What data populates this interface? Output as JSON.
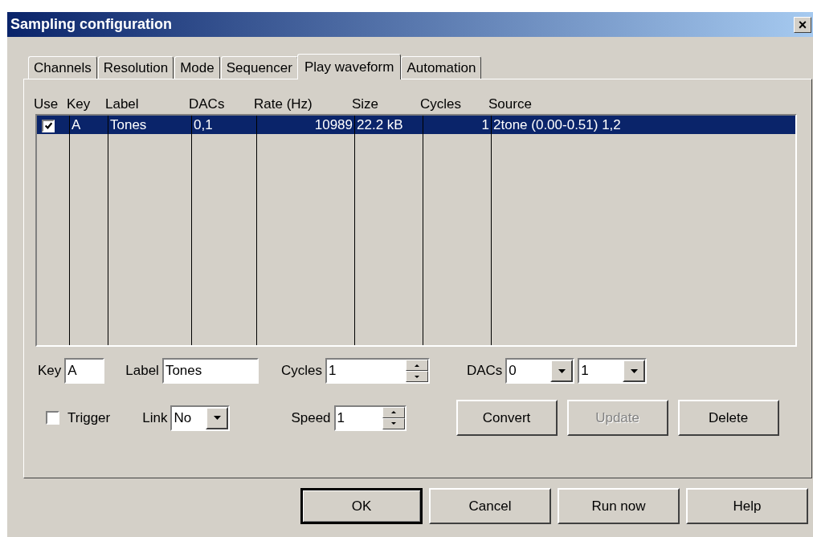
{
  "window": {
    "title": "Sampling configuration",
    "close": "×"
  },
  "tabs": [
    {
      "label": "Channels",
      "selected": false
    },
    {
      "label": "Resolution",
      "selected": false
    },
    {
      "label": "Mode",
      "selected": false
    },
    {
      "label": "Sequencer",
      "selected": false
    },
    {
      "label": "Play waveform",
      "selected": true
    },
    {
      "label": "Automation",
      "selected": false
    }
  ],
  "table": {
    "columns": [
      "Use",
      "Key",
      "Label",
      "DACs",
      "Rate (Hz)",
      "Size",
      "Cycles",
      "Source"
    ],
    "rows": [
      {
        "selected": true,
        "use_checked": true,
        "cells": [
          "",
          "A",
          "Tones",
          "0,1",
          "10989",
          "22.2 kB",
          "1",
          "2tone (0.00-0.51) 1,2"
        ]
      }
    ]
  },
  "form": {
    "key": {
      "label": "Key",
      "value": "A"
    },
    "label": {
      "label": "Label",
      "value": "Tones"
    },
    "cycles": {
      "label": "Cycles",
      "value": "1"
    },
    "dacs": {
      "label": "DACs",
      "values": [
        "0",
        "1"
      ]
    },
    "trigger": {
      "label": "Trigger",
      "checked": false
    },
    "link": {
      "label": "Link",
      "value": "No"
    },
    "speed": {
      "label": "Speed",
      "value": "1"
    },
    "actions": [
      {
        "label": "Convert",
        "disabled": false
      },
      {
        "label": "Update",
        "disabled": true
      },
      {
        "label": "Delete",
        "disabled": false
      }
    ]
  },
  "buttons": [
    {
      "label": "OK",
      "default": true
    },
    {
      "label": "Cancel",
      "default": false
    },
    {
      "label": "Run now",
      "default": false
    },
    {
      "label": "Help",
      "default": false
    }
  ]
}
